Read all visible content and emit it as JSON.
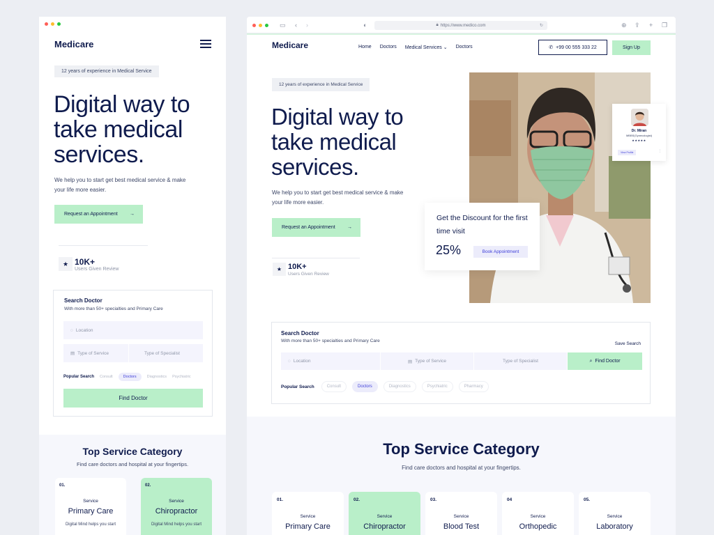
{
  "colors": {
    "brand_navy": "#0f1b4d",
    "accent_green": "#b9efc9",
    "accent_lavender": "#ececfb",
    "accent_purple": "#3d3dd9",
    "page_bg": "#eceef3"
  },
  "mobile": {
    "logo": "Medicare",
    "menu_icon": "hamburger-icon",
    "badge": "12 years of experience in Medical Service",
    "hero_title": "Digital way to take medical services.",
    "subtitle": "We help you to start get best medical service & make your life more easier.",
    "cta_label": "Request an Appointment",
    "cta_arrow": "→",
    "stat_icon": "star-icon",
    "stat_value": "10K+",
    "stat_label": "Users Given Review",
    "search": {
      "title": "Search Doctor",
      "subtitle": "With more than 50+ specialties and Primary Care",
      "location_placeholder": "Location",
      "service_placeholder": "Type of Service",
      "specialist_placeholder": "Type of Specialist",
      "popular_label": "Popular Search",
      "popular_tags": [
        "Consult",
        "Doctors",
        "Diagnostics",
        "Psychiatric"
      ],
      "selected_tag": "Doctors",
      "find_label": "Find Doctor"
    },
    "category": {
      "title": "Top Service Category",
      "subtitle": "Find care doctors and hospital at your fingertips.",
      "cards": [
        {
          "num": "01.",
          "kind": "Service",
          "name": "Primary Care",
          "desc": "Digital Mind helps you start"
        },
        {
          "num": "02.",
          "kind": "Service",
          "name": "Chiropractor",
          "desc": "Digital Mind helps you start"
        }
      ]
    }
  },
  "desktop": {
    "url": "https://www.medico.com",
    "logo": "Medicare",
    "nav": [
      "Home",
      "Doctors",
      "Medical Services",
      "Doctors"
    ],
    "phone": "+99 00 555 333 22",
    "signup": "Sign Up",
    "badge": "12 years of experience in Medical Service",
    "hero_title": "Digital way to take medical services.",
    "subtitle": "We help you to start get best medical service & make your life more easier.",
    "cta_label": "Request an Appointment",
    "cta_arrow": "→",
    "stat_value": "10K+",
    "stat_label": "Users Given Review",
    "doctor_card": {
      "name": "Dr. Miran",
      "specialty": "MBBS(Gynecologist)",
      "rating": "★★★★★",
      "view_label": "View Profile"
    },
    "discount": {
      "title": "Get the Discount for the first time visit",
      "percent": "25%",
      "button": "Book Appointment"
    },
    "search": {
      "title": "Search Doctor",
      "subtitle": "With more than 50+ specialties and Primary Care",
      "save_label": "Save Search",
      "location_placeholder": "Location",
      "service_placeholder": "Type of Service",
      "specialist_placeholder": "Type of Specialist",
      "find_label": "Find Doctor",
      "popular_label": "Popular Search",
      "popular_tags": [
        "Consult",
        "Doctors",
        "Diagnostics",
        "Psychiatric",
        "Pharmacy"
      ],
      "selected_tag": "Doctors"
    },
    "category": {
      "title": "Top Service Category",
      "subtitle": "Find care doctors and hospital at your fingertips.",
      "cards": [
        {
          "num": "01.",
          "kind": "Service",
          "name": "Primary Care"
        },
        {
          "num": "02.",
          "kind": "Service",
          "name": "Chiropractor"
        },
        {
          "num": "03.",
          "kind": "Service",
          "name": "Blood Test"
        },
        {
          "num": "04",
          "kind": "Service",
          "name": "Orthopedic"
        },
        {
          "num": "05.",
          "kind": "Service",
          "name": "Laboratory"
        }
      ]
    }
  }
}
